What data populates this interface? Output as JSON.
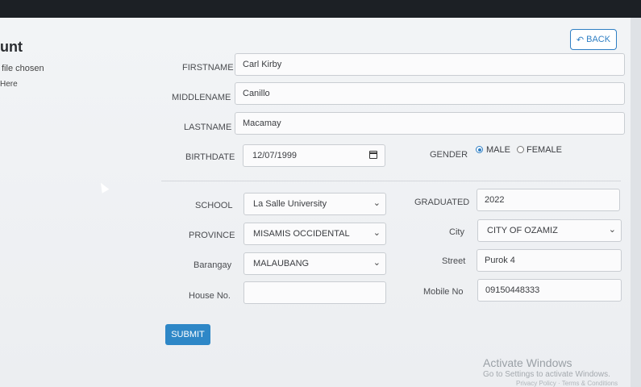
{
  "header": {
    "title": "unt",
    "file_status": "file chosen",
    "hint": "Here"
  },
  "actions": {
    "back_label": "BACK",
    "submit_label": "SUBMIT"
  },
  "fields": {
    "firstname": {
      "label": "FIRSTNAME",
      "value": "Carl Kirby"
    },
    "middlename": {
      "label": "MIDDLENAME",
      "value": "Canillo"
    },
    "lastname": {
      "label": "LASTNAME",
      "value": "Macamay"
    },
    "birthdate": {
      "label": "BIRTHDATE",
      "value": "12/07/1999"
    },
    "gender": {
      "label": "GENDER",
      "options": [
        "MALE",
        "FEMALE"
      ],
      "selected": "MALE"
    },
    "school": {
      "label": "SCHOOL",
      "value": "La Salle University"
    },
    "graduated": {
      "label": "GRADUATED",
      "value": "2022"
    },
    "province": {
      "label": "PROVINCE",
      "value": "MISAMIS OCCIDENTAL"
    },
    "city": {
      "label": "City",
      "value": "CITY OF OZAMIZ"
    },
    "barangay": {
      "label": "Barangay",
      "value": "MALAUBANG"
    },
    "street": {
      "label": "Street",
      "value": "Purok 4"
    },
    "house_no": {
      "label": "House No.",
      "value": ""
    },
    "mobile_no": {
      "label": "Mobile No",
      "value": "09150448333"
    }
  },
  "watermark": {
    "title": "Activate Windows",
    "subtitle": "Go to Settings to activate Windows.",
    "links": "Privacy Policy · Terms & Conditions"
  },
  "icons": {
    "back": "undo-arrow-icon",
    "calendar": "calendar-icon",
    "dropdown": "chevron-down-icon"
  },
  "colors": {
    "accent": "#2e87c7",
    "background": "#eceef1"
  }
}
